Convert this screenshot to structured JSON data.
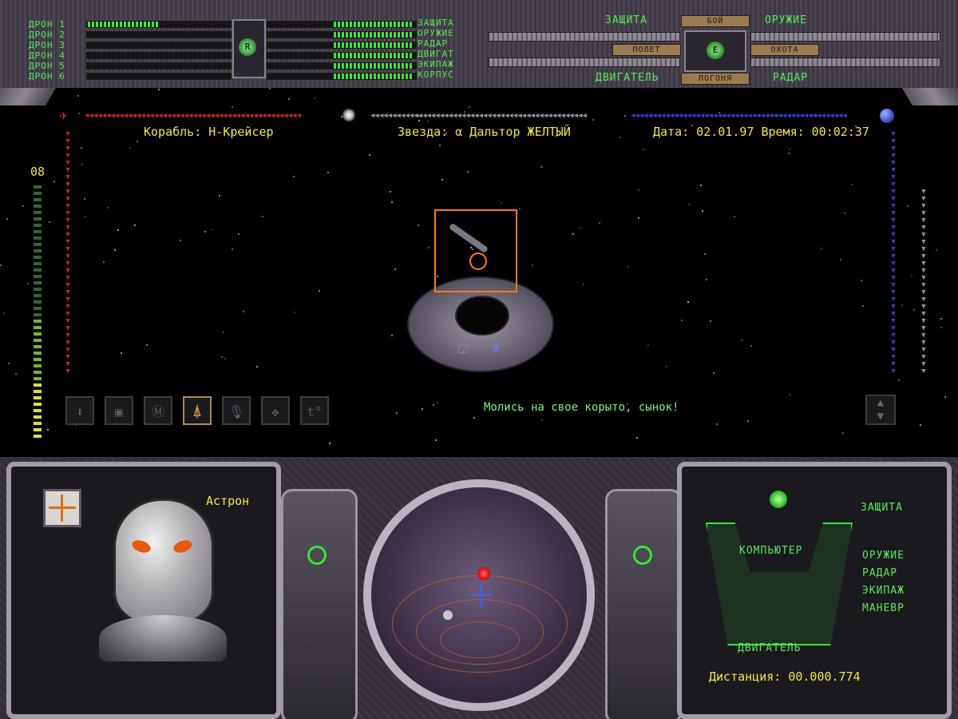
{
  "top_panel": {
    "drones": [
      "ДРОН 1",
      "ДРОН 2",
      "ДРОН 3",
      "ДРОН 4",
      "ДРОН 5",
      "ДРОН 6"
    ],
    "drone_emblem": "R",
    "systems": [
      "ЗАЩИТА",
      "ОРУЖИЕ",
      "РАДАР",
      "ДВИГАТ",
      "ЭКИПАЖ",
      "КОРПУС"
    ],
    "modes": {
      "top_left": "ЗАЩИТА",
      "top_right": "ОРУЖИЕ",
      "bottom_left": "ДВИГАТЕЛЬ",
      "bottom_right": "РАДАР",
      "battle": "БОЙ",
      "flight": "ПОЛЕТ",
      "hunt": "ОХОТА",
      "chase": "ПОГОНЯ",
      "center_emblem": "E"
    }
  },
  "hud": {
    "ship": "Корабль: Н-Крейсер",
    "star": "Звезда: α Дальтор ЖЕЛТЫЙ",
    "datetime": "Дата: 02.01.97 Время: 00:02:37",
    "left_gauge_value": "08",
    "message": "Молись на свое корыто, сынок!"
  },
  "toolbar": {
    "icons": [
      {
        "name": "down-arrow-icon",
        "glyph": "⬇"
      },
      {
        "name": "map-icon",
        "glyph": "▣"
      },
      {
        "name": "m-target-icon",
        "glyph": "Ⓜ"
      },
      {
        "name": "ship-icon",
        "glyph": "⍋"
      },
      {
        "name": "microphone-icon",
        "glyph": "🎙"
      },
      {
        "name": "expand-icon",
        "glyph": "✥"
      },
      {
        "name": "temperature-icon",
        "glyph": "t°"
      }
    ],
    "active_index": 3
  },
  "pilot": {
    "name": "Астрон"
  },
  "ship_status": {
    "systems": [
      "ЗАЩИТА",
      "КОМПЬЮТЕР",
      "ОРУЖИЕ",
      "РАДАР",
      "ЭКИПАЖ",
      "МАНЕВР",
      "ДВИГАТЕЛЬ"
    ],
    "distance": "Дистанция: 00.000.774"
  },
  "colors": {
    "hud_text": "#f2e64a",
    "system_text": "#5be65b",
    "left_arrows": "#c42424",
    "right_arrows": "#3a3ac8",
    "target_box": "#ff7a1a"
  }
}
